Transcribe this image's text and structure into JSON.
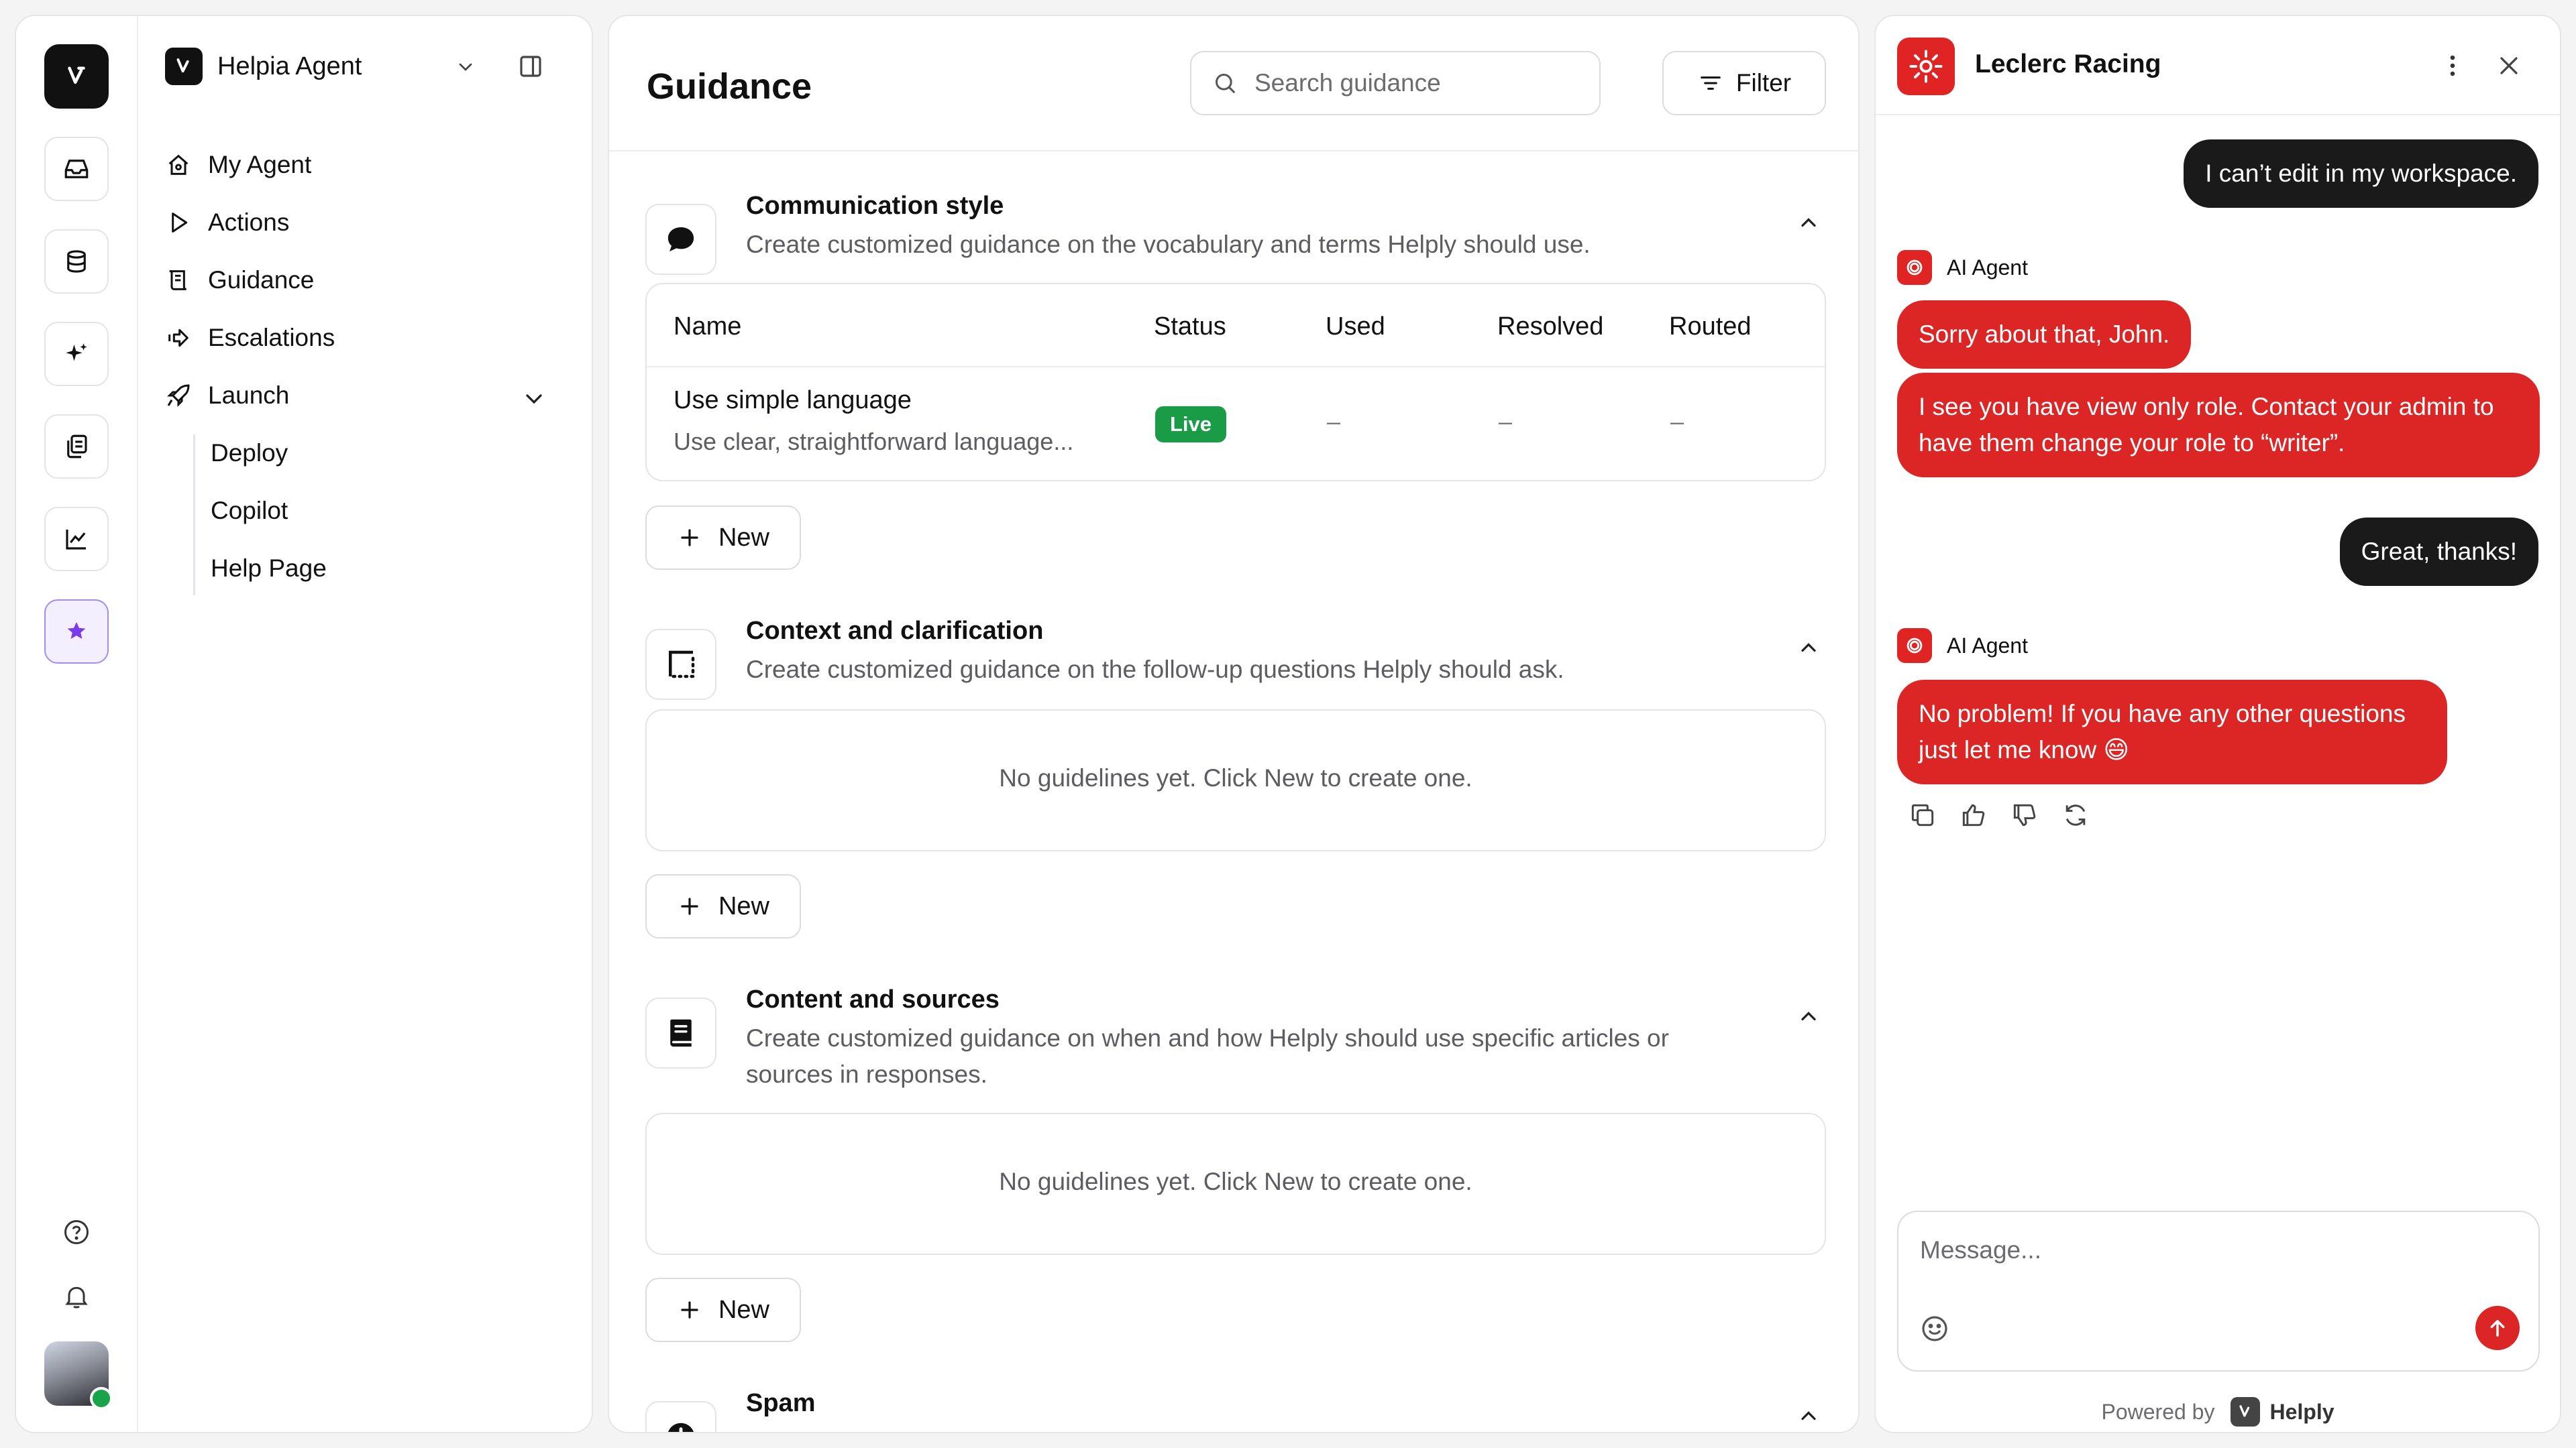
{
  "sidebar": {
    "agent_name": "Helpia Agent",
    "items": [
      {
        "label": "My Agent"
      },
      {
        "label": "Actions"
      },
      {
        "label": "Guidance"
      },
      {
        "label": "Escalations"
      },
      {
        "label": "Launch"
      }
    ],
    "launch_children": [
      "Deploy",
      "Copilot",
      "Help Page"
    ]
  },
  "main": {
    "title": "Guidance",
    "search_placeholder": "Search guidance",
    "filter_label": "Filter",
    "new_label": "New",
    "empty_text": "No guidelines yet. Click New to create one.",
    "sections": [
      {
        "title": "Communication style",
        "description": "Create customized guidance on the vocabulary and terms Helply should use.",
        "icon": "speech-bubble-icon"
      },
      {
        "title": "Context and clarification",
        "description": "Create customized guidance on the follow-up questions Helply should ask.",
        "icon": "frame-icon"
      },
      {
        "title": "Content and sources",
        "description": "Create customized guidance on when and how Helply should use specific articles or sources in responses.",
        "icon": "book-icon"
      },
      {
        "title": "Spam",
        "description": "",
        "icon": "alert-icon"
      }
    ],
    "table": {
      "columns": [
        "Name",
        "Status",
        "Used",
        "Resolved",
        "Routed"
      ],
      "rows": [
        {
          "name": "Use simple language",
          "description": "Use clear, straightforward language...",
          "status": "Live",
          "used": "–",
          "resolved": "–",
          "routed": "–"
        }
      ]
    }
  },
  "chat": {
    "brand_name": "Leclerc Racing",
    "agent_label": "AI Agent",
    "messages": [
      {
        "from": "user",
        "text": "I can’t edit in my workspace."
      },
      {
        "from": "bot",
        "text": "Sorry about that, John."
      },
      {
        "from": "bot",
        "text": "I see you have view only role. Contact your admin to have them change your role to “writer”."
      },
      {
        "from": "user",
        "text": "Great, thanks!"
      },
      {
        "from": "bot",
        "text": "No problem! If you have any other questions just let me know 😄"
      }
    ],
    "composer_placeholder": "Message...",
    "powered_by": "Powered by",
    "powered_brand": "Helply"
  },
  "colors": {
    "accent": "#dc2626",
    "live": "#1a9b46",
    "dark": "#1a1a1a",
    "rail_active": "#a58bf5"
  }
}
